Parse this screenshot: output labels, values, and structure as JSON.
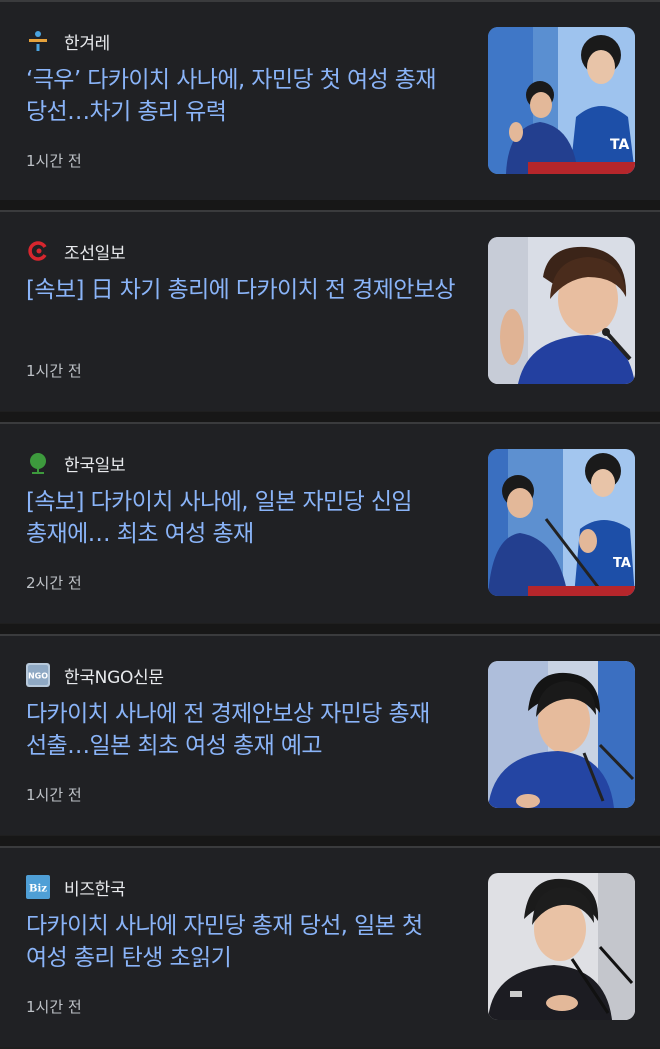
{
  "articles": [
    {
      "source": "한겨레",
      "source_icon": "hankyoreh-logo-icon",
      "headline": "‘극우’ 다카이치 사나에, 자민당 첫 여성 총재 당선…차기 총리 유력",
      "time": "1시간 전",
      "thumbnail": "takaichi-photo-podium-icon"
    },
    {
      "source": "조선일보",
      "source_icon": "chosun-logo-icon",
      "headline": "[속보] 日 차기 총리에 다카이치 전 경제안보상",
      "time": "1시간 전",
      "thumbnail": "takaichi-photo-closeup-icon"
    },
    {
      "source": "한국일보",
      "source_icon": "hankookilbo-logo-icon",
      "headline": "[속보] 다카이치 사나에, 일본 자민당 신임 총재에… 최초 여성 총재",
      "time": "2시간 전",
      "thumbnail": "takaichi-photo-podium-icon"
    },
    {
      "source": "한국NGO신문",
      "source_icon": "ngo-news-logo-icon",
      "headline": "다카이치 사나에 전 경제안보상 자민당 총재 선출…일본 최초 여성 총재 예고",
      "time": "1시간 전",
      "thumbnail": "takaichi-photo-microphone-icon"
    },
    {
      "source": "비즈한국",
      "source_icon": "bizhankook-logo-icon",
      "headline": "다카이치 사나에 자민당 총재 당선, 일본 첫 여성 총리 탄생 초읽기",
      "time": "1시간 전",
      "thumbnail": "takaichi-photo-microphone-icon"
    }
  ],
  "logo_text": {
    "ngo": "NGO",
    "biz": "Biz"
  },
  "colors": {
    "background": "#202124",
    "headline": "#8ab4f8",
    "source": "#e8eaed",
    "time": "#bdc1c6"
  }
}
